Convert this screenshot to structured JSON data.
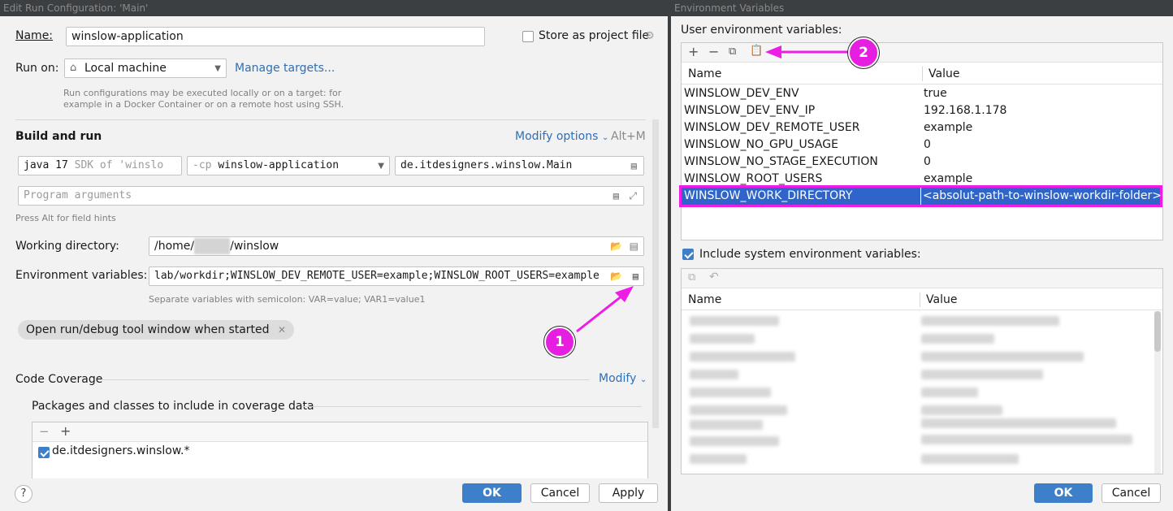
{
  "left": {
    "title": "Edit Run Configuration: 'Main'",
    "name_label": "Name:",
    "name_value": "winslow-application",
    "store_label": "Store as project file",
    "run_on_label": "Run on:",
    "run_on_value": "Local machine",
    "manage_targets": "Manage targets...",
    "run_on_hint_1": "Run configurations may be executed locally or on a target: for",
    "run_on_hint_2": "example in a Docker Container or on a remote host using SSH.",
    "build_run_title": "Build and run",
    "modify_options": "Modify options",
    "modify_shortcut": "Alt+M",
    "jdk_version": "java 17",
    "jdk_detail": "SDK of 'winslo",
    "cp_flag": "-cp",
    "cp_value": "winslow-application",
    "main_class": "de.itdesigners.winslow.Main",
    "program_args_placeholder": "Program arguments",
    "field_hint": "Press Alt for field hints",
    "working_dir_label": "Working directory:",
    "working_dir_prefix": "/home/",
    "working_dir_suffix": "/winslow",
    "env_label": "Environment variables:",
    "env_value": "lab/workdir;WINSLOW_DEV_REMOTE_USER=example;WINSLOW_ROOT_USERS=example",
    "env_hint": "Separate variables with semicolon: VAR=value; VAR1=value1",
    "open_tool_window": "Open run/debug tool window when started",
    "code_coverage": "Code Coverage",
    "modify": "Modify",
    "packages_title": "Packages and classes to include in coverage data",
    "package_item": "de.itdesigners.winslow.*",
    "ok": "OK",
    "cancel": "Cancel",
    "apply": "Apply",
    "help": "?"
  },
  "right": {
    "title": "Environment Variables",
    "user_env_label": "User environment variables:",
    "col_name": "Name",
    "col_value": "Value",
    "rows": [
      {
        "name": "WINSLOW_DEV_ENV",
        "value": "true"
      },
      {
        "name": "WINSLOW_DEV_ENV_IP",
        "value": "192.168.1.178"
      },
      {
        "name": "WINSLOW_DEV_REMOTE_USER",
        "value": "example"
      },
      {
        "name": "WINSLOW_NO_GPU_USAGE",
        "value": "0"
      },
      {
        "name": "WINSLOW_NO_STAGE_EXECUTION",
        "value": "0"
      },
      {
        "name": "WINSLOW_ROOT_USERS",
        "value": "example"
      },
      {
        "name": "WINSLOW_WORK_DIRECTORY",
        "value": "<absolut-path-to-winslow-workdir-folder>"
      }
    ],
    "include_system_label": "Include system environment variables:",
    "sys_col_name": "Name",
    "sys_col_value": "Value",
    "ok": "OK",
    "cancel": "Cancel"
  },
  "annotations": {
    "badge_1": "1",
    "badge_2": "2",
    "color": "#ee1de6"
  },
  "icons": {
    "add": "plus-icon",
    "remove": "minus-icon",
    "copy": "copy-icon",
    "paste": "paste-icon",
    "folder": "folder-icon",
    "expand": "expand-icon",
    "home": "home-icon"
  }
}
